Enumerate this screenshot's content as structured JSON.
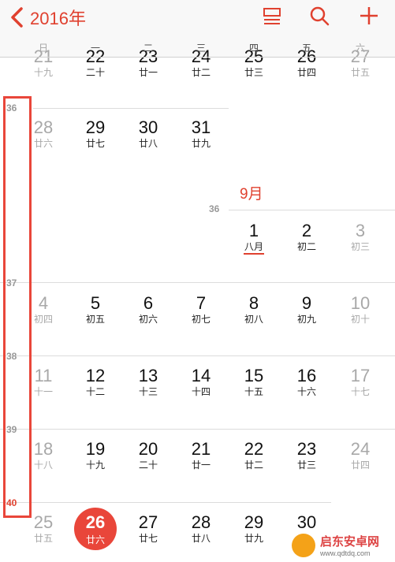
{
  "header": {
    "year_label": "2016年",
    "icons": [
      "chevron-left-icon",
      "list-view-icon",
      "search-icon",
      "add-icon"
    ],
    "accent_color": "#e0412f"
  },
  "weekdays": [
    "日",
    "一",
    "二",
    "三",
    "四",
    "五",
    "六"
  ],
  "partial_row": [
    {
      "day": "21",
      "lunar": "十九"
    },
    {
      "day": "22",
      "lunar": "二十"
    },
    {
      "day": "23",
      "lunar": "廿一"
    },
    {
      "day": "24",
      "lunar": "廿二"
    },
    {
      "day": "25",
      "lunar": "廿三"
    },
    {
      "day": "26",
      "lunar": "廿四"
    },
    {
      "day": "27",
      "lunar": "廿五"
    }
  ],
  "aug_last_week": {
    "week_number": "36",
    "days": [
      {
        "day": "28",
        "lunar": "廿六"
      },
      {
        "day": "29",
        "lunar": "廿七"
      },
      {
        "day": "30",
        "lunar": "廿八"
      },
      {
        "day": "31",
        "lunar": "廿九"
      }
    ]
  },
  "september": {
    "month_label": "9月",
    "first_week": {
      "week_number": "36",
      "days": [
        {
          "day": "1",
          "lunar": "八月"
        },
        {
          "day": "2",
          "lunar": "初二"
        },
        {
          "day": "3",
          "lunar": "初三"
        }
      ]
    },
    "weeks": [
      {
        "week_number": "37",
        "days": [
          {
            "day": "4",
            "lunar": "初四"
          },
          {
            "day": "5",
            "lunar": "初五"
          },
          {
            "day": "6",
            "lunar": "初六"
          },
          {
            "day": "7",
            "lunar": "初七"
          },
          {
            "day": "8",
            "lunar": "初八"
          },
          {
            "day": "9",
            "lunar": "初九"
          },
          {
            "day": "10",
            "lunar": "初十"
          }
        ]
      },
      {
        "week_number": "38",
        "days": [
          {
            "day": "11",
            "lunar": "十一"
          },
          {
            "day": "12",
            "lunar": "十二"
          },
          {
            "day": "13",
            "lunar": "十三"
          },
          {
            "day": "14",
            "lunar": "十四"
          },
          {
            "day": "15",
            "lunar": "十五"
          },
          {
            "day": "16",
            "lunar": "十六"
          },
          {
            "day": "17",
            "lunar": "十七"
          }
        ]
      },
      {
        "week_number": "39",
        "days": [
          {
            "day": "18",
            "lunar": "十八"
          },
          {
            "day": "19",
            "lunar": "十九"
          },
          {
            "day": "20",
            "lunar": "二十"
          },
          {
            "day": "21",
            "lunar": "廿一"
          },
          {
            "day": "22",
            "lunar": "廿二"
          },
          {
            "day": "23",
            "lunar": "廿三"
          },
          {
            "day": "24",
            "lunar": "廿四"
          }
        ]
      },
      {
        "week_number": "40",
        "days": [
          {
            "day": "25",
            "lunar": "廿五"
          },
          {
            "day": "26",
            "lunar": "廿六"
          },
          {
            "day": "27",
            "lunar": "廿七"
          },
          {
            "day": "28",
            "lunar": "廿八"
          },
          {
            "day": "29",
            "lunar": "廿九"
          },
          {
            "day": "30",
            "lunar": ""
          }
        ]
      }
    ],
    "today_day": "26"
  },
  "watermark": {
    "name": "启东安卓网",
    "url": "www.qdtdq.com"
  }
}
